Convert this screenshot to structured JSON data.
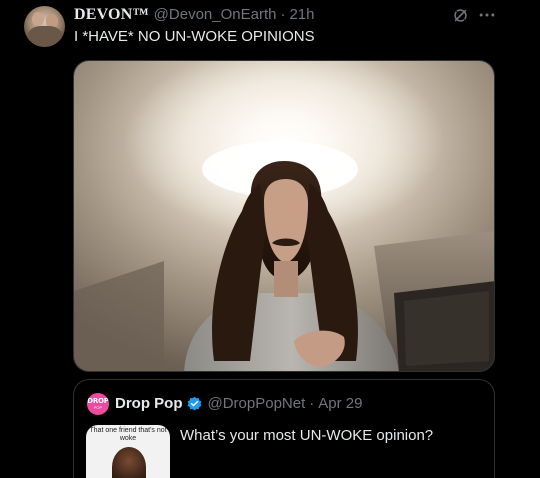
{
  "post": {
    "author": {
      "display_name": "DEVON™",
      "handle": "@Devon_OnEarth",
      "separator": "·",
      "time": "21h"
    },
    "text": "I *HAVE* NO UN-WOKE OPINIONS",
    "icons": {
      "grok": "grok-icon",
      "more": "more-icon"
    },
    "media": {
      "kind": "video-still"
    }
  },
  "quote": {
    "avatar": {
      "text": "DROP",
      "subtext": "POP",
      "bg_color": "#ee4aa1"
    },
    "author_name": "Drop Pop",
    "verified_color": "#1d9bf0",
    "handle": "@DropPopNet",
    "separator": "·",
    "date": "Apr 29",
    "thumbnail_caption": "That one friend that's not woke",
    "text": "What’s your most UN-WOKE opinion?"
  },
  "colors": {
    "background": "#000000",
    "text_primary": "#e7e9ea",
    "text_secondary": "#71767b",
    "border": "#2f3336",
    "accent": "#1d9bf0"
  }
}
